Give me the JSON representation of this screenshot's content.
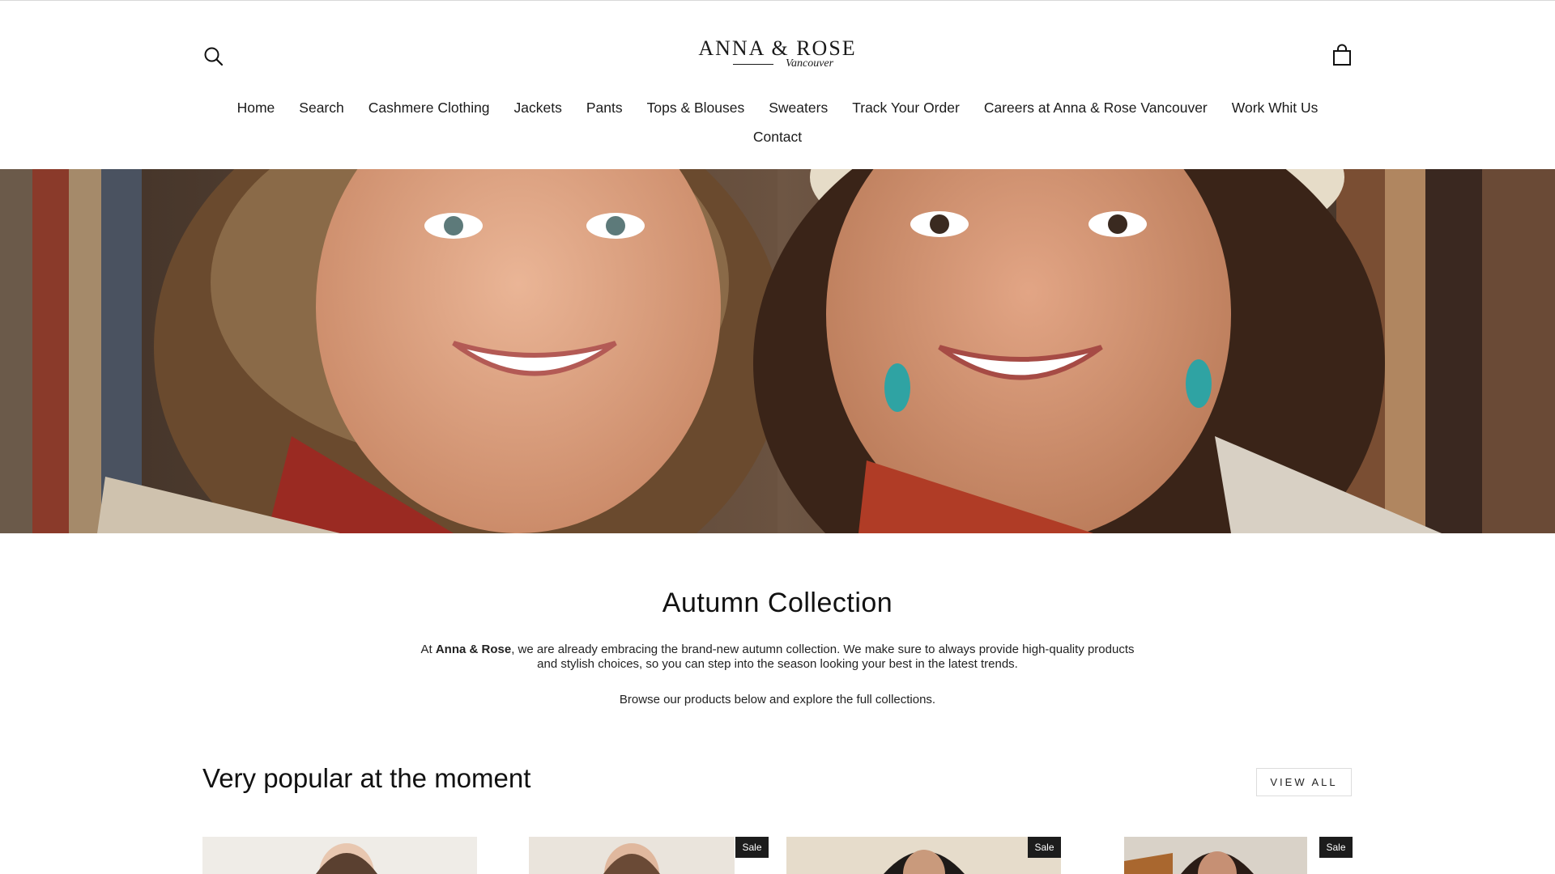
{
  "header": {
    "logo": {
      "main": "ANNA & ROSE",
      "sub": "Vancouver"
    },
    "nav_row1": [
      "Home",
      "Search",
      "Cashmere Clothing",
      "Jackets",
      "Pants",
      "Tops & Blouses",
      "Sweaters",
      "Track Your Order",
      "Careers at Anna & Rose Vancouver",
      "Work Whit Us"
    ],
    "nav_row2": [
      "Contact"
    ]
  },
  "intro": {
    "title": "Autumn Collection",
    "p1_prefix": "At ",
    "p1_brand": "Anna & Rose",
    "p1_rest": ", we are already embracing the brand-new autumn collection. We make sure to always provide high-quality products and stylish choices, so you can step into the season looking your best in the latest trends.",
    "p2": "Browse our products below and explore the full collections."
  },
  "popular": {
    "title": "Very popular at the moment",
    "view_all": "VIEW ALL",
    "badge": "Sale"
  },
  "colors": {
    "text": "#111111",
    "badge_bg": "#1c1c1c",
    "border": "#dcdcdc"
  }
}
